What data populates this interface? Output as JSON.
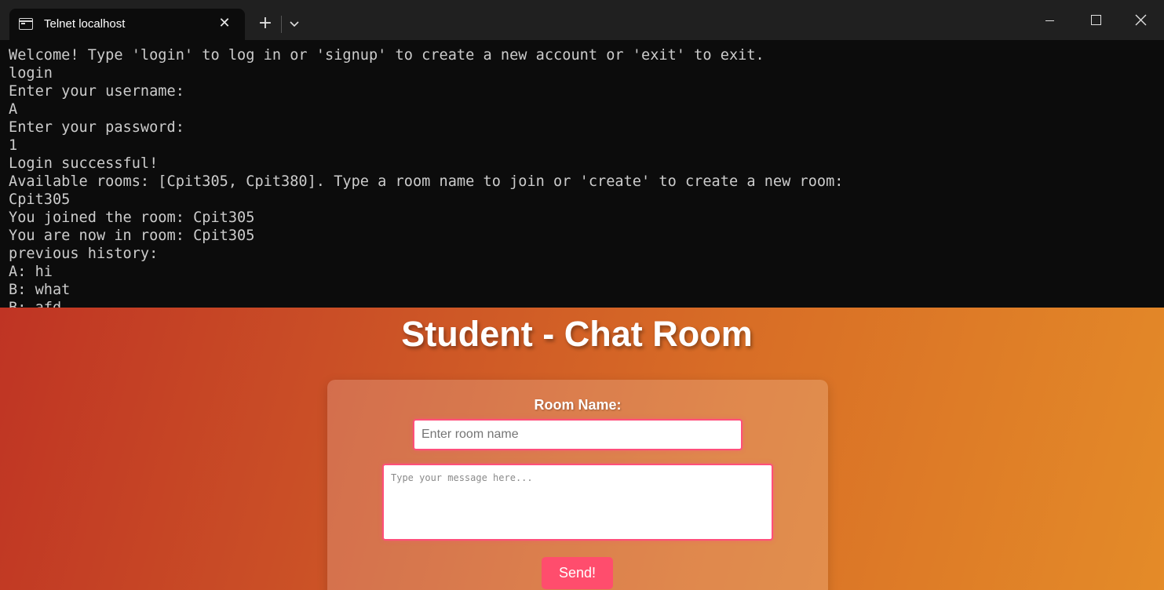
{
  "terminal": {
    "tab_title": "Telnet localhost",
    "lines": [
      "Welcome! Type 'login' to log in or 'signup' to create a new account or 'exit' to exit.",
      "login",
      "Enter your username:",
      "A",
      "Enter your password:",
      "1",
      "Login successful!",
      "Available rooms: [Cpit305, Cpit380]. Type a room name to join or 'create' to create a new room:",
      "Cpit305",
      "You joined the room: Cpit305",
      "You are now in room: Cpit305",
      "previous history:",
      "A: hi",
      "B: what",
      "B: afd"
    ]
  },
  "chat": {
    "title": "Student - Chat Room",
    "room_label": "Room Name:",
    "room_placeholder": "Enter room name",
    "message_placeholder": "Type your message here...",
    "send_label": "Send!"
  },
  "colors": {
    "gradient_start": "#bf3424",
    "gradient_end": "#e48b28",
    "accent": "#ff4d6d"
  }
}
